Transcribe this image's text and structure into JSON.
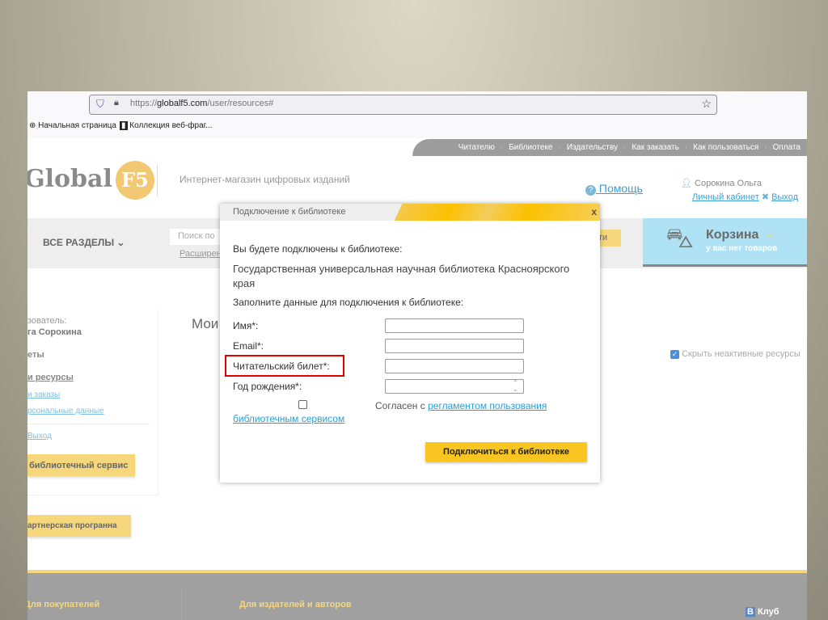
{
  "browser": {
    "url_prefix": "https://",
    "url_domain": "globalf5.com",
    "url_path": "/user/resources#",
    "bookmarks": [
      "Начальная страница",
      "Коллекция веб-фраг..."
    ]
  },
  "topnav": [
    "Читателю",
    "Библиотеке",
    "Издательству",
    "Как заказать",
    "Как пользоваться",
    "Оплата"
  ],
  "header": {
    "logo": "Global F5",
    "logo_text": "Global",
    "logo_badge": "F5",
    "tagline": "Интернет-магазин цифровых изданий",
    "help": "Помощь",
    "user_name": "Сорокина Ольга",
    "cabinet": "Личный кабинет",
    "logout": "Выход"
  },
  "band": {
    "all_sections": "ВСЕ РАЗДЕЛЫ",
    "search_placeholder": "Поиск по",
    "advanced": "Расширен",
    "search_btn": "ти",
    "cart_title": "Корзина",
    "cart_sub": "у вас нет товаров"
  },
  "sidebar": {
    "user_label": "зователь:",
    "user_name": "га Сорокина",
    "group": "еты",
    "items": [
      "и ресурсы",
      "и заказы",
      "рсональные данные"
    ],
    "logout": "Выход",
    "lib_btn": "библиотечный сервис",
    "partner_btn": "артнерская програнна"
  },
  "main": {
    "title": "Мои",
    "hide_inactive": "Скрыть неактивные ресурсы",
    "hide_checked": true
  },
  "modal": {
    "title": "Подключение к библиотеке",
    "close": "x",
    "intro": "Вы будете подключены к библиотеке:",
    "library": "Государственная универсальная научная библиотека Красноярского края",
    "fill": "Заполните данные для подключения к библиотеке:",
    "fields": [
      {
        "label": "Имя*:",
        "value": ""
      },
      {
        "label": "Email*:",
        "value": ""
      },
      {
        "label": "Читательский билет*:",
        "value": ""
      },
      {
        "label": "Год рождения*:",
        "value": ""
      }
    ],
    "agree_text": "Согласен с ",
    "agree_link": "регламентом пользования",
    "agree_link2": "библиотечным сервисом",
    "submit": "Подключиться к библиотеке",
    "highlight_color": "#e00000"
  },
  "footer": {
    "buyers": "Для покупателей",
    "publishers": "Для издателей и авторов",
    "club": "Клуб"
  }
}
